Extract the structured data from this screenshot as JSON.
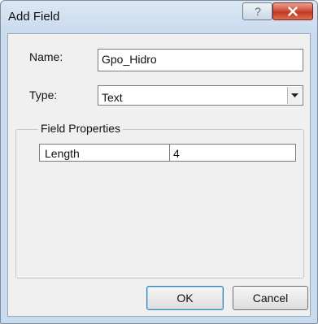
{
  "window": {
    "title": "Add Field"
  },
  "form": {
    "name_label": "Name:",
    "name_value": "Gpo_Hidro",
    "type_label": "Type:",
    "type_value": "Text"
  },
  "field_properties": {
    "legend": "Field Properties",
    "rows": [
      {
        "name": "Length",
        "value": "4"
      }
    ]
  },
  "buttons": {
    "ok": "OK",
    "cancel": "Cancel"
  },
  "icons": {
    "help": "help-icon",
    "close": "close-icon",
    "dropdown": "chevron-down-icon"
  }
}
